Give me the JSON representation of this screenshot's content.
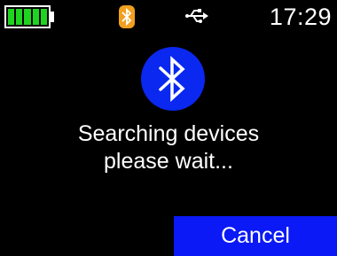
{
  "status_bar": {
    "battery_level": 1.0,
    "battery_color": "#1fd41f",
    "bluetooth_icon": "bluetooth-icon",
    "bluetooth_badge_color": "#f0a020",
    "usb_icon": "usb-icon",
    "time": "17:29"
  },
  "main": {
    "icon": "bluetooth-icon",
    "icon_background": "#0a28f0",
    "message_line1": "Searching devices",
    "message_line2": "please wait..."
  },
  "actions": {
    "cancel_label": "Cancel",
    "cancel_color": "#0a19f5"
  }
}
